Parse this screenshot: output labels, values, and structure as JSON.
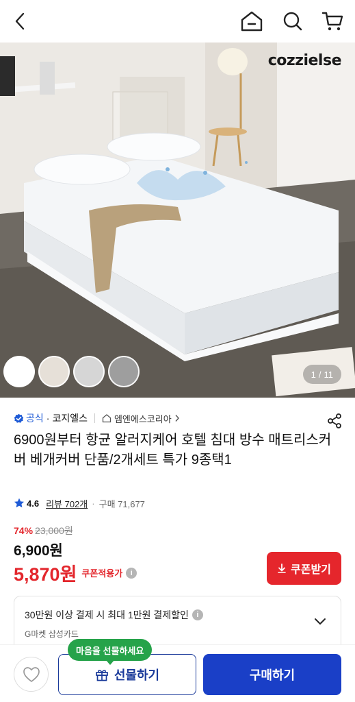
{
  "topbar": {
    "back_icon": "chevron-left-icon",
    "home_icon": "home-icon",
    "search_icon": "search-icon",
    "cart_icon": "cart-icon"
  },
  "hero": {
    "brand_logo": "cozzielse",
    "swatches": [
      "#ffffff",
      "#e6e0d8",
      "#d6d6d6",
      "#9e9e9e"
    ],
    "pager": {
      "current": "1",
      "separator": "/",
      "total": "11"
    }
  },
  "seller": {
    "official_label": "공식",
    "separator": "·",
    "name": "코지엘스",
    "store_name": "엠엔에스코리아"
  },
  "product": {
    "title": "6900원부터 항균 알러지케어 호텔 침대 방수 매트리스커버 베개커버 단품/2개세트 특가 9종택1",
    "rating": "4.6",
    "review_text": "리뷰 702개",
    "purchase_text": "구매 71,677",
    "discount_rate": "74%",
    "original_price": "23,000원",
    "price": "6,900원",
    "coupon_price": "5,870원",
    "coupon_applied_label": "쿠폰적용가"
  },
  "coupon_button": {
    "label": "쿠폰받기"
  },
  "card_benefit": {
    "line1": "30만원 이상 결제 시 최대 1만원 결제할인",
    "line2": "G마켓 삼성카드"
  },
  "bottom": {
    "gift_tooltip": "마음을 선물하세요",
    "gift_label": "선물하기",
    "buy_label": "구매하기"
  },
  "colors": {
    "accent_red": "#e3262c",
    "brand_blue": "#1a3fc7",
    "tooltip_green": "#26a34a"
  }
}
